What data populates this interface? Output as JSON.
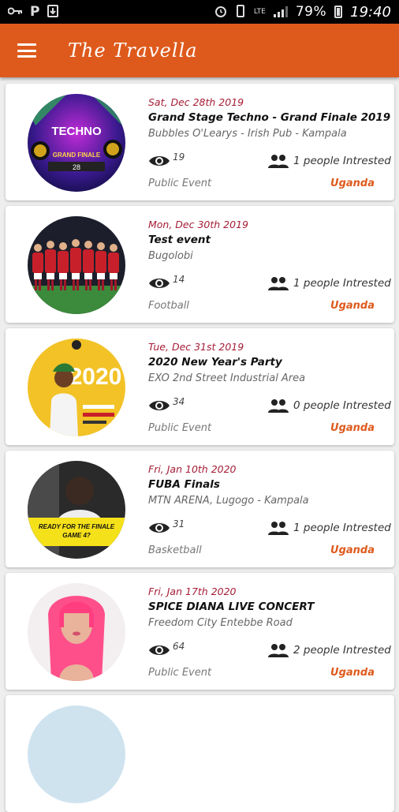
{
  "status_bar": {
    "left_icons": [
      "key-icon",
      "p-icon",
      "download-icon"
    ],
    "network": "LTE",
    "battery_percent": "79%",
    "time": "19:40"
  },
  "app_bar": {
    "title": "The Travella",
    "menu_icon": "hamburger-menu-icon"
  },
  "colors": {
    "primary": "#de5a1c",
    "date": "#a51d36",
    "country": "#de5a1c"
  },
  "events": [
    {
      "date": "Sat, Dec 28th 2019",
      "title": "Grand Stage Techno - Grand Finale 2019",
      "location": "Bubbles O'Learys - Irish Pub - Kampala",
      "views": "19",
      "interest": "1 people Intrested",
      "category": "Public Event",
      "country": "Uganda",
      "thumb_text": [
        "TECHNO",
        "GRAND FINALE",
        "28"
      ]
    },
    {
      "date": "Mon, Dec 30th 2019",
      "title": "Test event",
      "location": "Bugolobi",
      "views": "14",
      "interest": "1 people Intrested",
      "category": "Football",
      "country": "Uganda",
      "thumb_text": []
    },
    {
      "date": "Tue, Dec 31st 2019",
      "title": "2020 New Year's Party",
      "location": "EXO 2nd Street Industrial Area",
      "views": "34",
      "interest": "0 people Intrested",
      "category": "Public Event",
      "country": "Uganda",
      "thumb_text": [
        "2020"
      ]
    },
    {
      "date": "Fri, Jan 10th 2020",
      "title": "FUBA Finals",
      "location": "MTN ARENA, Lugogo - Kampala",
      "views": "31",
      "interest": "1 people Intrested",
      "category": "Basketball",
      "country": "Uganda",
      "thumb_text": [
        "READY FOR THE FINALE",
        "GAME 4?"
      ]
    },
    {
      "date": "Fri, Jan 17th 2020",
      "title": "SPICE DIANA LIVE CONCERT",
      "location": "Freedom City Entebbe Road",
      "views": "64",
      "interest": "2 people Intrested",
      "category": "Public Event",
      "country": "Uganda",
      "thumb_text": []
    }
  ]
}
